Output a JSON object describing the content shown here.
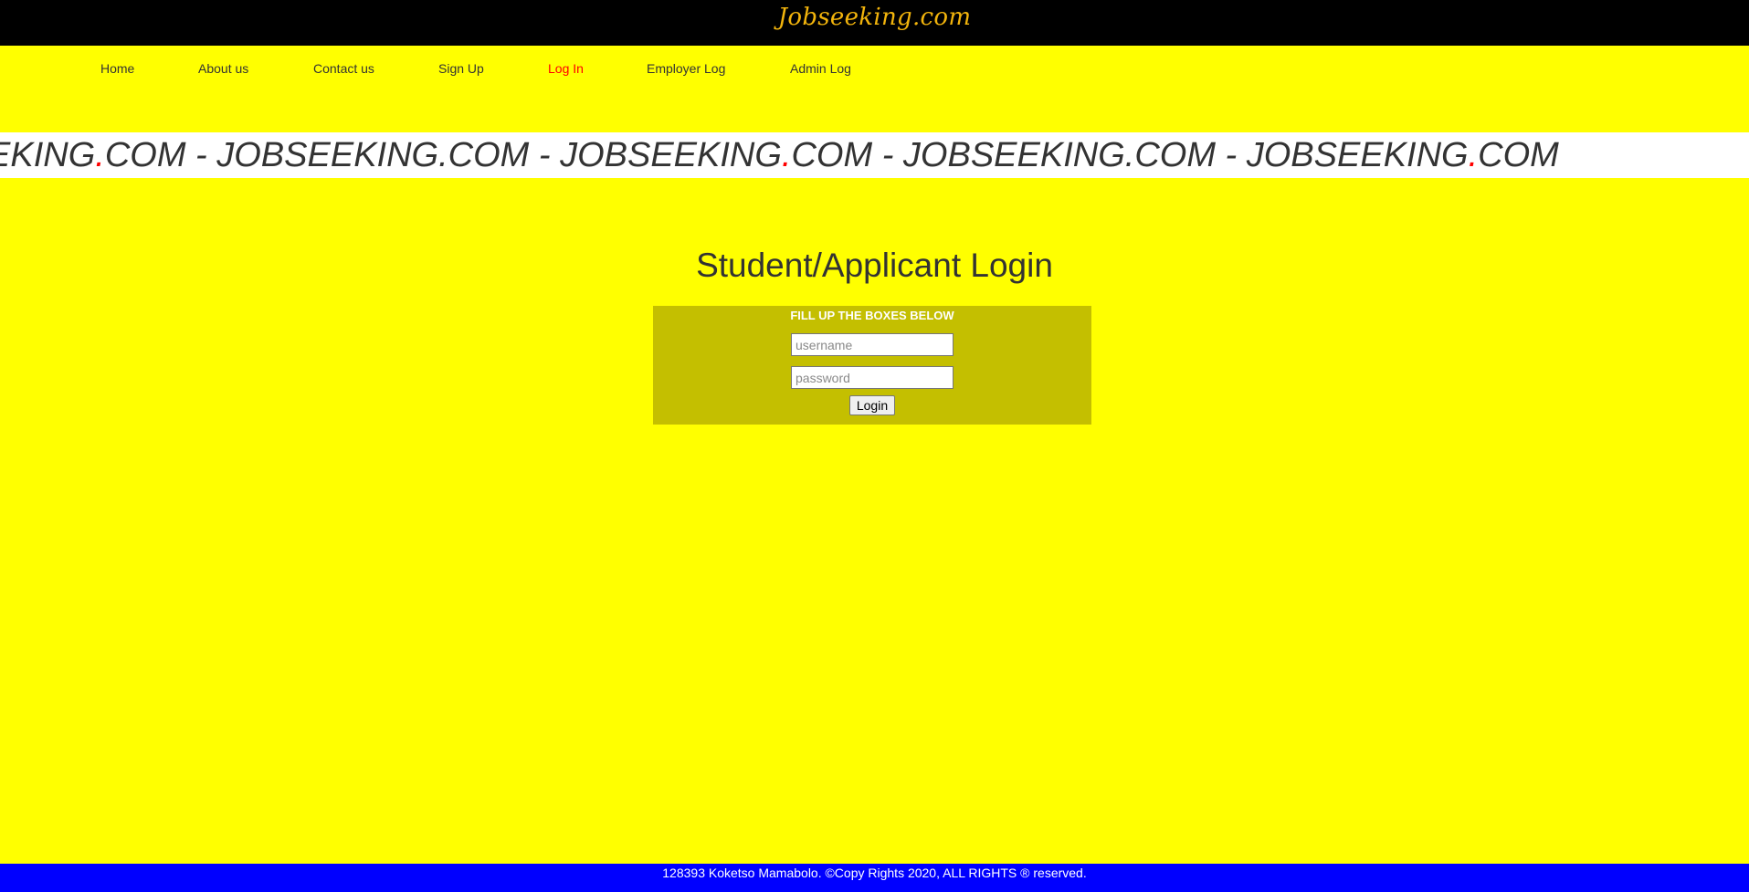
{
  "header": {
    "brand": "Jobseeking.com"
  },
  "nav": {
    "items": [
      {
        "label": "Home"
      },
      {
        "label": "About us"
      },
      {
        "label": "Contact us"
      },
      {
        "label": "Sign Up"
      },
      {
        "label": "Log In",
        "active": true
      },
      {
        "label": "Employer Log"
      },
      {
        "label": "Admin Log"
      }
    ]
  },
  "marquee": {
    "segments": [
      {
        "a": "EKING",
        "dot": ".",
        "b": "COM - "
      },
      {
        "text": "JOBSEEKING.COM - "
      },
      {
        "a": "JOBSEEKING",
        "dot": ".",
        "b": "COM - "
      },
      {
        "text": "JOBSEEKING.COM - "
      },
      {
        "a": "JOBSEEKING",
        "dot": ".",
        "b": "COM"
      }
    ]
  },
  "login": {
    "title": "Student/Applicant Login",
    "heading": "FILL UP THE BOXES BELOW",
    "username_placeholder": "username",
    "password_placeholder": "password",
    "button_label": "Login"
  },
  "footer": {
    "text": "128393 Koketso Mamabolo. ©Copy Rights 2020, ALL RIGHTS ® reserved."
  },
  "colors": {
    "page_background": "#ffff00",
    "header_background": "#000000",
    "brand": "#f2b40c",
    "active_nav": "#ff0000",
    "login_box": "#c4bf00",
    "footer_background": "#0000ff"
  }
}
